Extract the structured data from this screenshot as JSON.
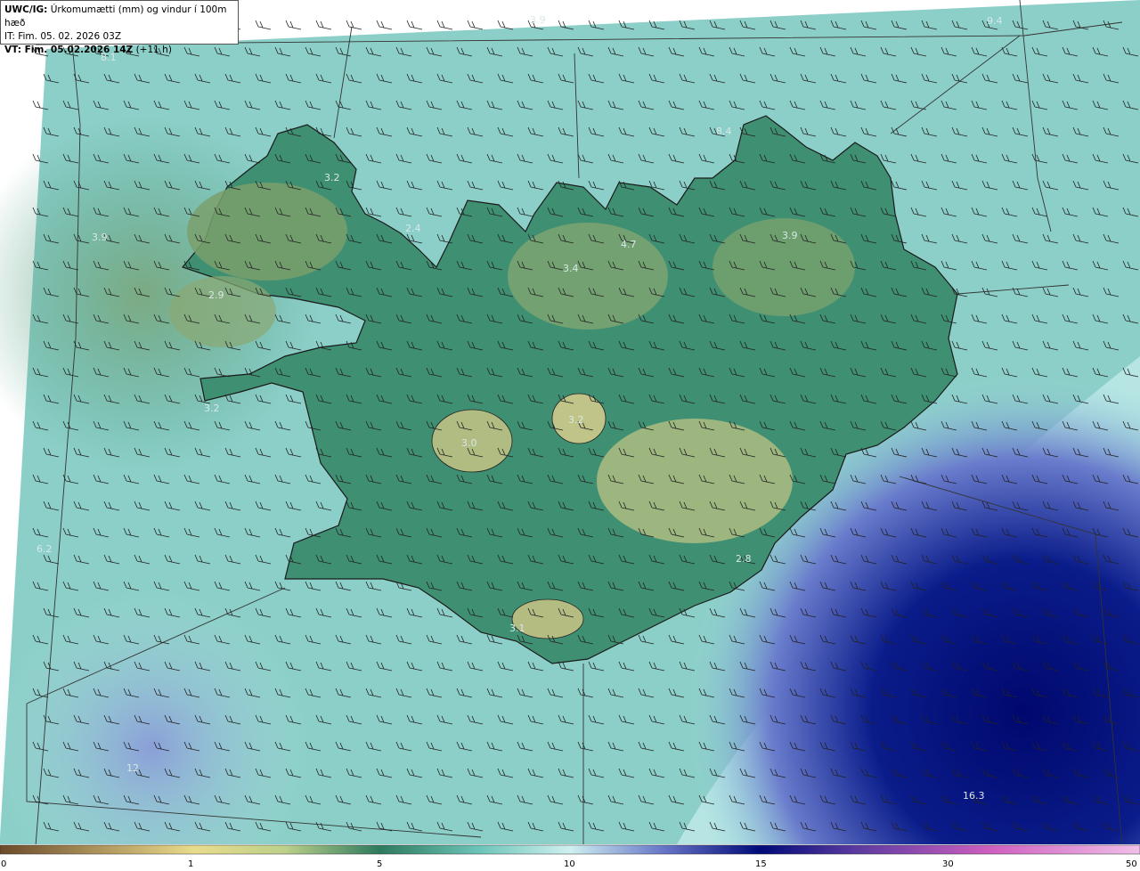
{
  "header": {
    "model": "UWC/IG:",
    "title": "Úrkomumætti (mm) og vindur í 100m hæð",
    "it_line": "IT: Fim. 05. 02. 2026 03Z",
    "vt_label": "VT: Fim. 05.02.2026 14Z",
    "vt_offset": "(+11 h)"
  },
  "map_values": [
    {
      "id": "v1",
      "text": "8.1"
    },
    {
      "id": "v2",
      "text": "3.9"
    },
    {
      "id": "v3",
      "text": "9.4"
    },
    {
      "id": "v4",
      "text": "3.2"
    },
    {
      "id": "v5",
      "text": "3.9"
    },
    {
      "id": "v6",
      "text": "2.4"
    },
    {
      "id": "v7",
      "text": "8.4"
    },
    {
      "id": "v8",
      "text": "3.4"
    },
    {
      "id": "v9",
      "text": "4.7"
    },
    {
      "id": "v10",
      "text": "3.9"
    },
    {
      "id": "v11",
      "text": "2.9"
    },
    {
      "id": "v12",
      "text": "3.2"
    },
    {
      "id": "v13",
      "text": "3.0"
    },
    {
      "id": "v14",
      "text": "3.2"
    },
    {
      "id": "v15",
      "text": "6.2"
    },
    {
      "id": "v16",
      "text": "2.8"
    },
    {
      "id": "v17",
      "text": "3.1"
    },
    {
      "id": "v18",
      "text": "12"
    },
    {
      "id": "v19",
      "text": "16.3"
    }
  ],
  "colorbar": {
    "ticks": [
      "0",
      "1",
      "5",
      "10",
      "15",
      "30",
      "50"
    ],
    "colors": [
      "#6b4a2a",
      "#b8a064",
      "#e8dc8c",
      "#bcd08a",
      "#2e7a5e",
      "#6cc4b8",
      "#d0f0f0",
      "#6a78c8",
      "#000a78",
      "#5a3aa0",
      "#d060c0",
      "#f0c0e8"
    ]
  }
}
